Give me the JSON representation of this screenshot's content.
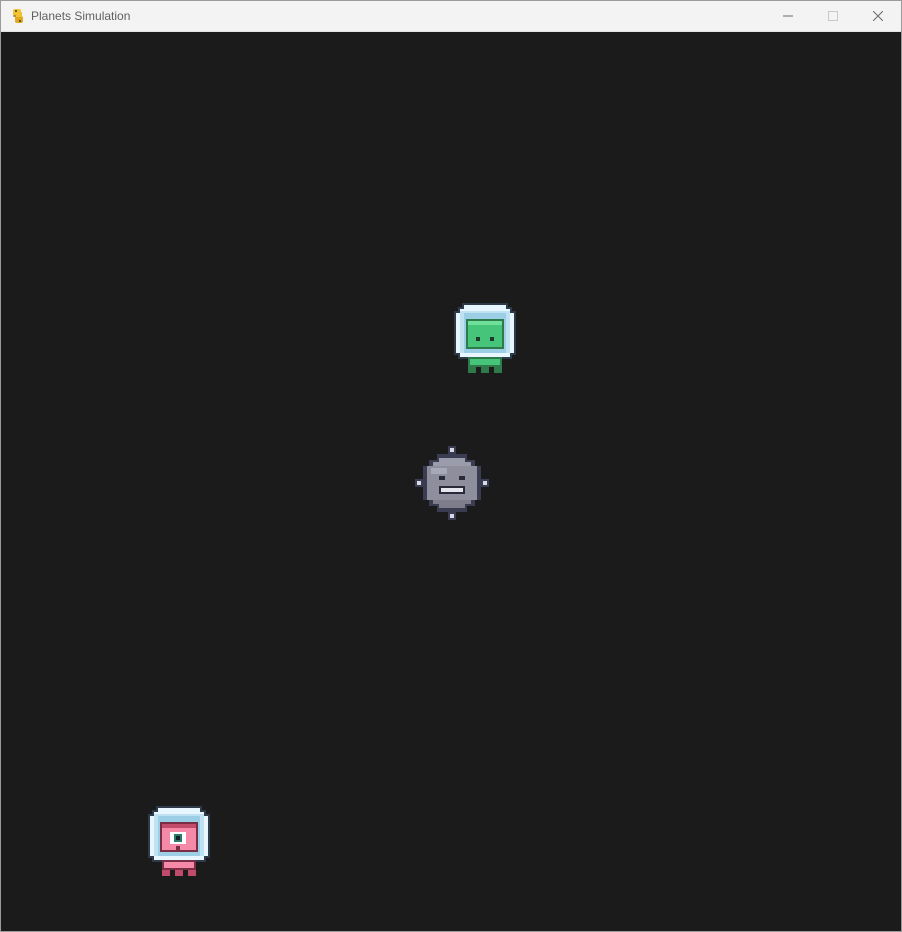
{
  "window": {
    "title": "Planets Simulation",
    "app_icon": "python-icon",
    "controls": {
      "minimize_icon": "minimize-icon",
      "maximize_icon": "maximize-icon",
      "close_icon": "close-icon"
    }
  },
  "canvas": {
    "background_color": "#1b1b1b",
    "sprites": [
      {
        "name": "green-alien-astronaut",
        "color": "#3fbf6a"
      },
      {
        "name": "gray-planet-face",
        "color": "#8e8e9c"
      },
      {
        "name": "pink-cyclops-alien-astronaut",
        "color": "#f58aa8"
      }
    ]
  }
}
